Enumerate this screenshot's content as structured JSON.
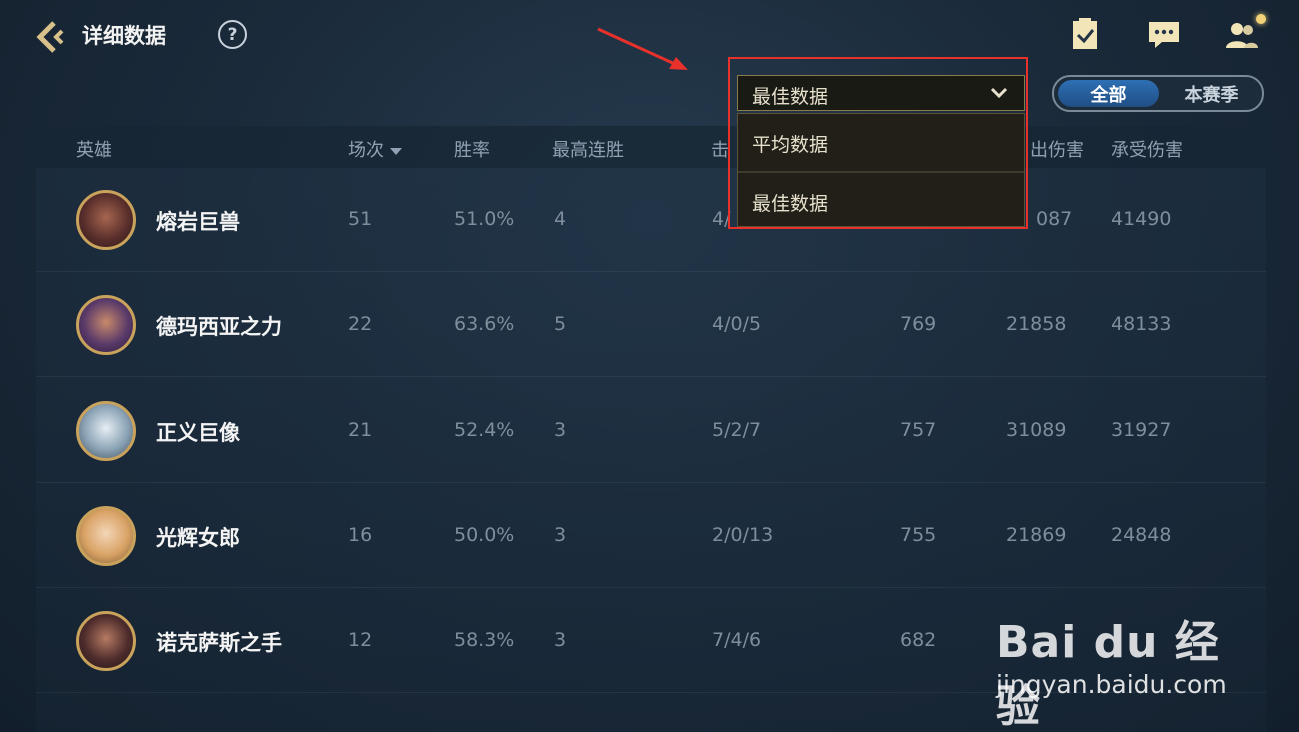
{
  "header": {
    "title": "详细数据",
    "help_label": "?"
  },
  "filter": {
    "selected": "最佳数据",
    "options": [
      "平均数据",
      "最佳数据"
    ]
  },
  "season_toggle": {
    "all_label": "全部",
    "season_label": "本赛季",
    "active": "全部"
  },
  "table": {
    "columns": [
      "英雄",
      "场次",
      "胜率",
      "最高连胜",
      "击",
      "出伤害",
      "承受伤害"
    ],
    "rows": [
      {
        "hero": "熔岩巨兽",
        "games": "51",
        "winrate": "51.0%",
        "streak": "4",
        "kda": "4/",
        "gold": "",
        "dmg": "087",
        "taken": "41490"
      },
      {
        "hero": "德玛西亚之力",
        "games": "22",
        "winrate": "63.6%",
        "streak": "5",
        "kda": "4/0/5",
        "gold": "769",
        "dmg": "21858",
        "taken": "48133"
      },
      {
        "hero": "正义巨像",
        "games": "21",
        "winrate": "52.4%",
        "streak": "3",
        "kda": "5/2/7",
        "gold": "757",
        "dmg": "31089",
        "taken": "31927"
      },
      {
        "hero": "光辉女郎",
        "games": "16",
        "winrate": "50.0%",
        "streak": "3",
        "kda": "2/0/13",
        "gold": "755",
        "dmg": "21869",
        "taken": "24848"
      },
      {
        "hero": "诺克萨斯之手",
        "games": "12",
        "winrate": "58.3%",
        "streak": "3",
        "kda": "7/4/6",
        "gold": "682",
        "dmg": "",
        "taken": ""
      }
    ]
  },
  "watermark": {
    "logo": "Bai du 经验",
    "url": "jingyan.baidu.com"
  },
  "colors": {
    "accent_blue": "#2e6fb4",
    "gold_border": "#c9a25c",
    "highlight_red": "#e8312a"
  },
  "icons": [
    "back-arrow-icon",
    "help-icon",
    "checklist-icon",
    "chat-icon",
    "friends-icon",
    "chevron-down-icon"
  ]
}
